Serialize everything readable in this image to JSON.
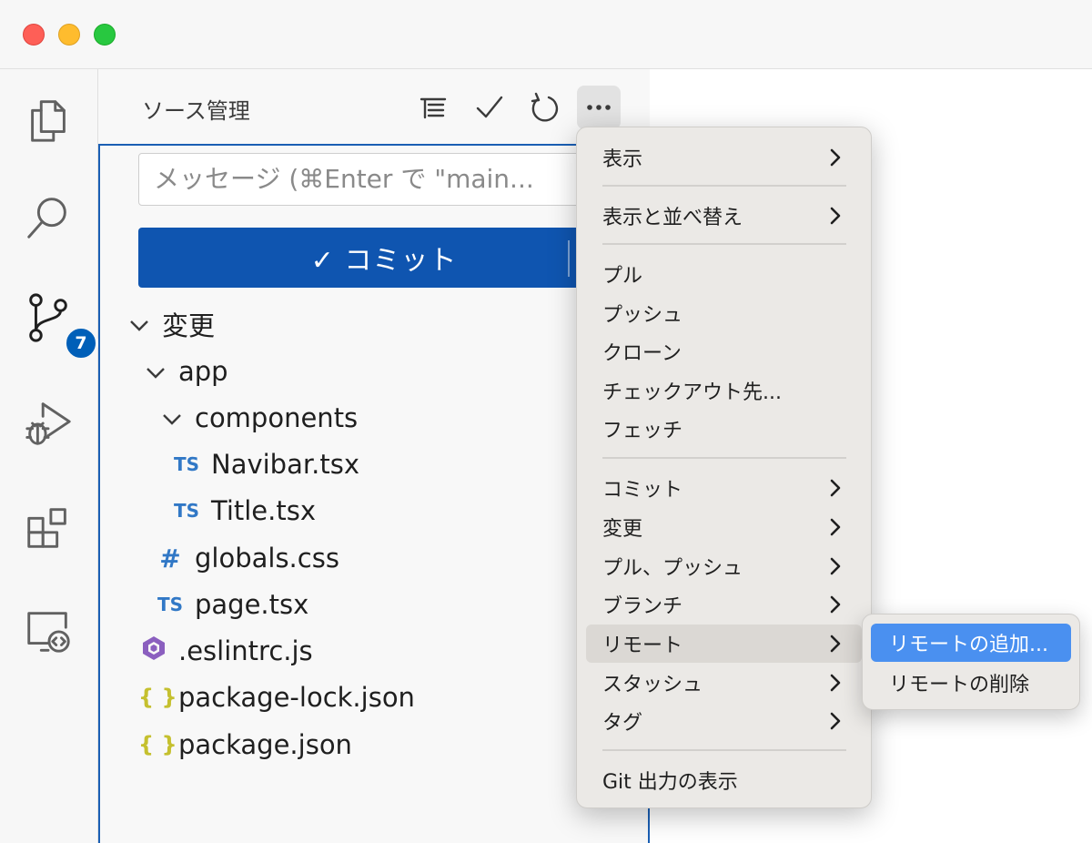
{
  "sidebar": {
    "title": "ソース管理",
    "message_placeholder": "メッセージ (⌘Enter で \"main...",
    "commit_label": "✓ コミット",
    "badge_count": "7"
  },
  "tree": {
    "changes": "変更",
    "app": "app",
    "components": "components",
    "navibar": "Navibar.tsx",
    "title_tsx": "Title.tsx",
    "globals": "globals.css",
    "page": "page.tsx",
    "eslintrc": ".eslintrc.js",
    "package_lock": "package-lock.json",
    "package": "package.json",
    "ts_icon": "TS",
    "hash_icon": "#",
    "brace_icon": "{ }"
  },
  "menu": {
    "view": "表示",
    "view_sort": "表示と並べ替え",
    "pull": "プル",
    "push": "プッシュ",
    "clone": "クローン",
    "checkout": "チェックアウト先...",
    "fetch": "フェッチ",
    "commit": "コミット",
    "changes": "変更",
    "pull_push": "プル、プッシュ",
    "branch": "ブランチ",
    "remote": "リモート",
    "stash": "スタッシュ",
    "tag": "タグ",
    "git_output": "Git 出力の表示"
  },
  "submenu": {
    "add_remote": "リモートの追加...",
    "remove_remote": "リモートの削除"
  },
  "colors": {
    "accent": "#0f55b0",
    "badge": "#005fb8",
    "submenu_selected": "#4a90f0"
  }
}
